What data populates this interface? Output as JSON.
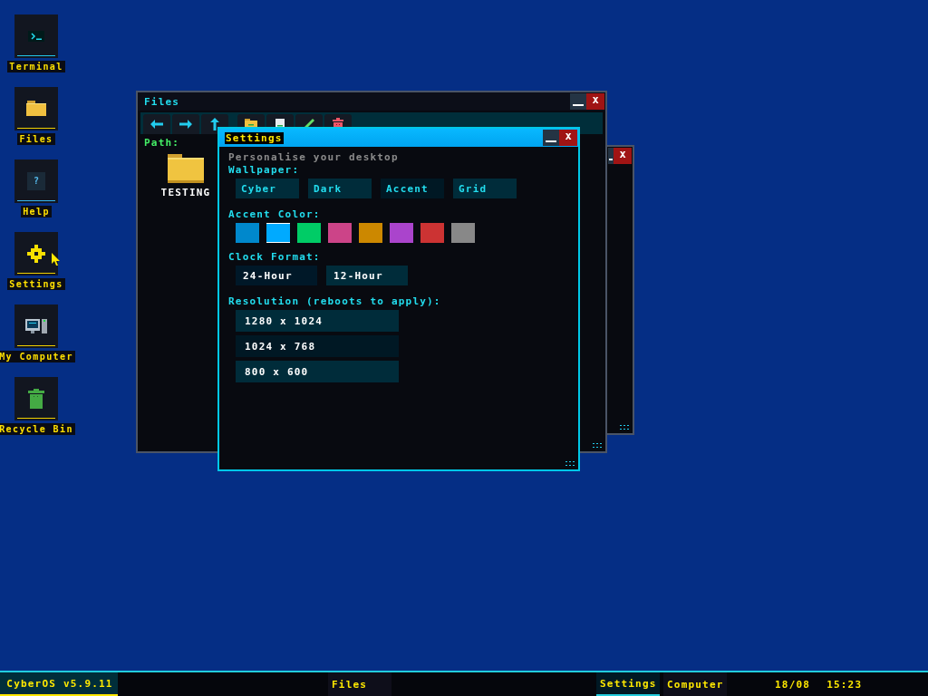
{
  "desktop_icons": [
    {
      "kind": "terminal",
      "label": "Terminal"
    },
    {
      "kind": "files",
      "label": "Files"
    },
    {
      "kind": "help",
      "label": "Help",
      "glyph": "?"
    },
    {
      "kind": "settings",
      "label": "Settings"
    },
    {
      "kind": "computer",
      "label": "My Computer"
    },
    {
      "kind": "recycle",
      "label": "Recycle Bin"
    }
  ],
  "back_window": {
    "close": "x"
  },
  "files_window": {
    "title": "Files",
    "close": "x",
    "toolbar": [
      {
        "kind": "back"
      },
      {
        "kind": "forward"
      },
      {
        "kind": "up"
      },
      {
        "kind": "new-folder"
      },
      {
        "kind": "new-file"
      },
      {
        "kind": "rename"
      },
      {
        "kind": "delete"
      }
    ],
    "path_label": "Path:",
    "items": [
      {
        "name": "TESTING"
      }
    ]
  },
  "settings_window": {
    "title": "Settings",
    "close": "x",
    "subtitle": "Personalise your desktop",
    "wallpaper": {
      "label": "Wallpaper:",
      "options": [
        {
          "label": "Cyber",
          "selected": false
        },
        {
          "label": "Dark",
          "selected": false
        },
        {
          "label": "Accent",
          "selected": true
        },
        {
          "label": "Grid",
          "selected": false
        }
      ]
    },
    "accent": {
      "label": "Accent Color:",
      "swatches": [
        {
          "color": "#0088cc",
          "selected": false
        },
        {
          "color": "#00aaff",
          "selected": true
        },
        {
          "color": "#00cc66",
          "selected": false
        },
        {
          "color": "#cc4488",
          "selected": false
        },
        {
          "color": "#cc8800",
          "selected": false
        },
        {
          "color": "#aa44cc",
          "selected": false
        },
        {
          "color": "#cc3333",
          "selected": false
        },
        {
          "color": "#888888",
          "selected": false
        }
      ]
    },
    "clock": {
      "label": "Clock Format:",
      "options": [
        {
          "label": "24-Hour",
          "selected": true
        },
        {
          "label": "12-Hour",
          "selected": false
        }
      ]
    },
    "resolution": {
      "label": "Resolution (reboots to apply):",
      "options": [
        {
          "label": "1280 x 1024",
          "selected": false
        },
        {
          "label": "1024 x 768",
          "selected": true
        },
        {
          "label": "800 x 600",
          "selected": false
        }
      ]
    }
  },
  "taskbar": {
    "start": "CyberOS v5.9.11",
    "tasks": [
      {
        "label": "Files",
        "selected": false
      },
      {
        "label": "Settings",
        "selected": true
      },
      {
        "label": "Computer",
        "selected": false
      }
    ],
    "date": "18/08",
    "time": "15:23"
  }
}
